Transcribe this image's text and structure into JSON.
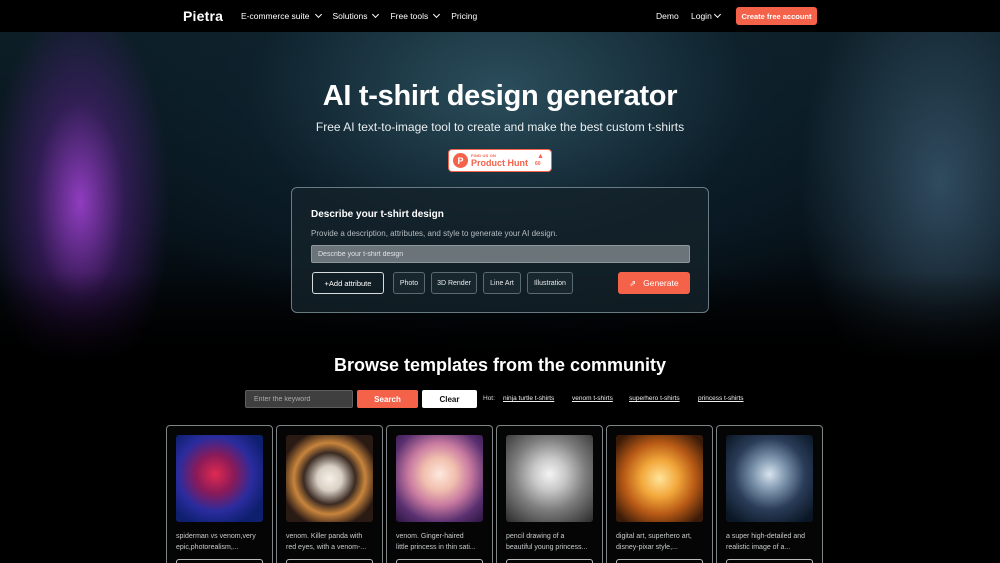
{
  "nav": {
    "logo": "Pietra",
    "links": [
      {
        "label": "E-commerce suite",
        "dropdown": true
      },
      {
        "label": "Solutions",
        "dropdown": true
      },
      {
        "label": "Free tools",
        "dropdown": true
      },
      {
        "label": "Pricing",
        "dropdown": false
      }
    ],
    "demo": "Demo",
    "login": "Login",
    "create_account": "Create free account"
  },
  "hero": {
    "title": "AI t-shirt design generator",
    "subtitle": "Free AI text-to-image tool to create and make the best custom t-shirts",
    "product_hunt": {
      "small": "FIND US ON",
      "name": "Product Hunt",
      "count": "60"
    }
  },
  "design": {
    "title": "Describe your t-shirt design",
    "description": "Provide a description, attributes, and style to generate your AI design.",
    "input_placeholder": "Describe your t-shirt design",
    "add_attribute": "+Add attribute",
    "chips": [
      "Photo",
      "3D Render",
      "Line Art",
      "Illustration"
    ],
    "generate": "Generate"
  },
  "browse": {
    "title": "Browse templates from the community",
    "search_placeholder": "Enter the keyword",
    "search": "Search",
    "clear": "Clear",
    "hot_label": "Hot:",
    "hot_links": [
      "ninja turtle t-shirts",
      "venom t-shirts",
      "superhero t-shirts",
      "princess t-shirts"
    ]
  },
  "templates": [
    {
      "caption_1": "spiderman vs venom,very",
      "caption_2": "epic,photorealism,..."
    },
    {
      "caption_1": "venom. Killer panda with",
      "caption_2": "red eyes, with a venom-..."
    },
    {
      "caption_1": "venom. Ginger-haired",
      "caption_2": "little princess in thin sati..."
    },
    {
      "caption_1": "pencil drawing of a",
      "caption_2": "beautiful young princess..."
    },
    {
      "caption_1": "digital art, superhero art,",
      "caption_2": "disney-pixar style,..."
    },
    {
      "caption_1": "a super high-detailed and",
      "caption_2": "realistic image of a..."
    }
  ],
  "colors": {
    "accent": "#f4624a",
    "background": "#000000"
  }
}
